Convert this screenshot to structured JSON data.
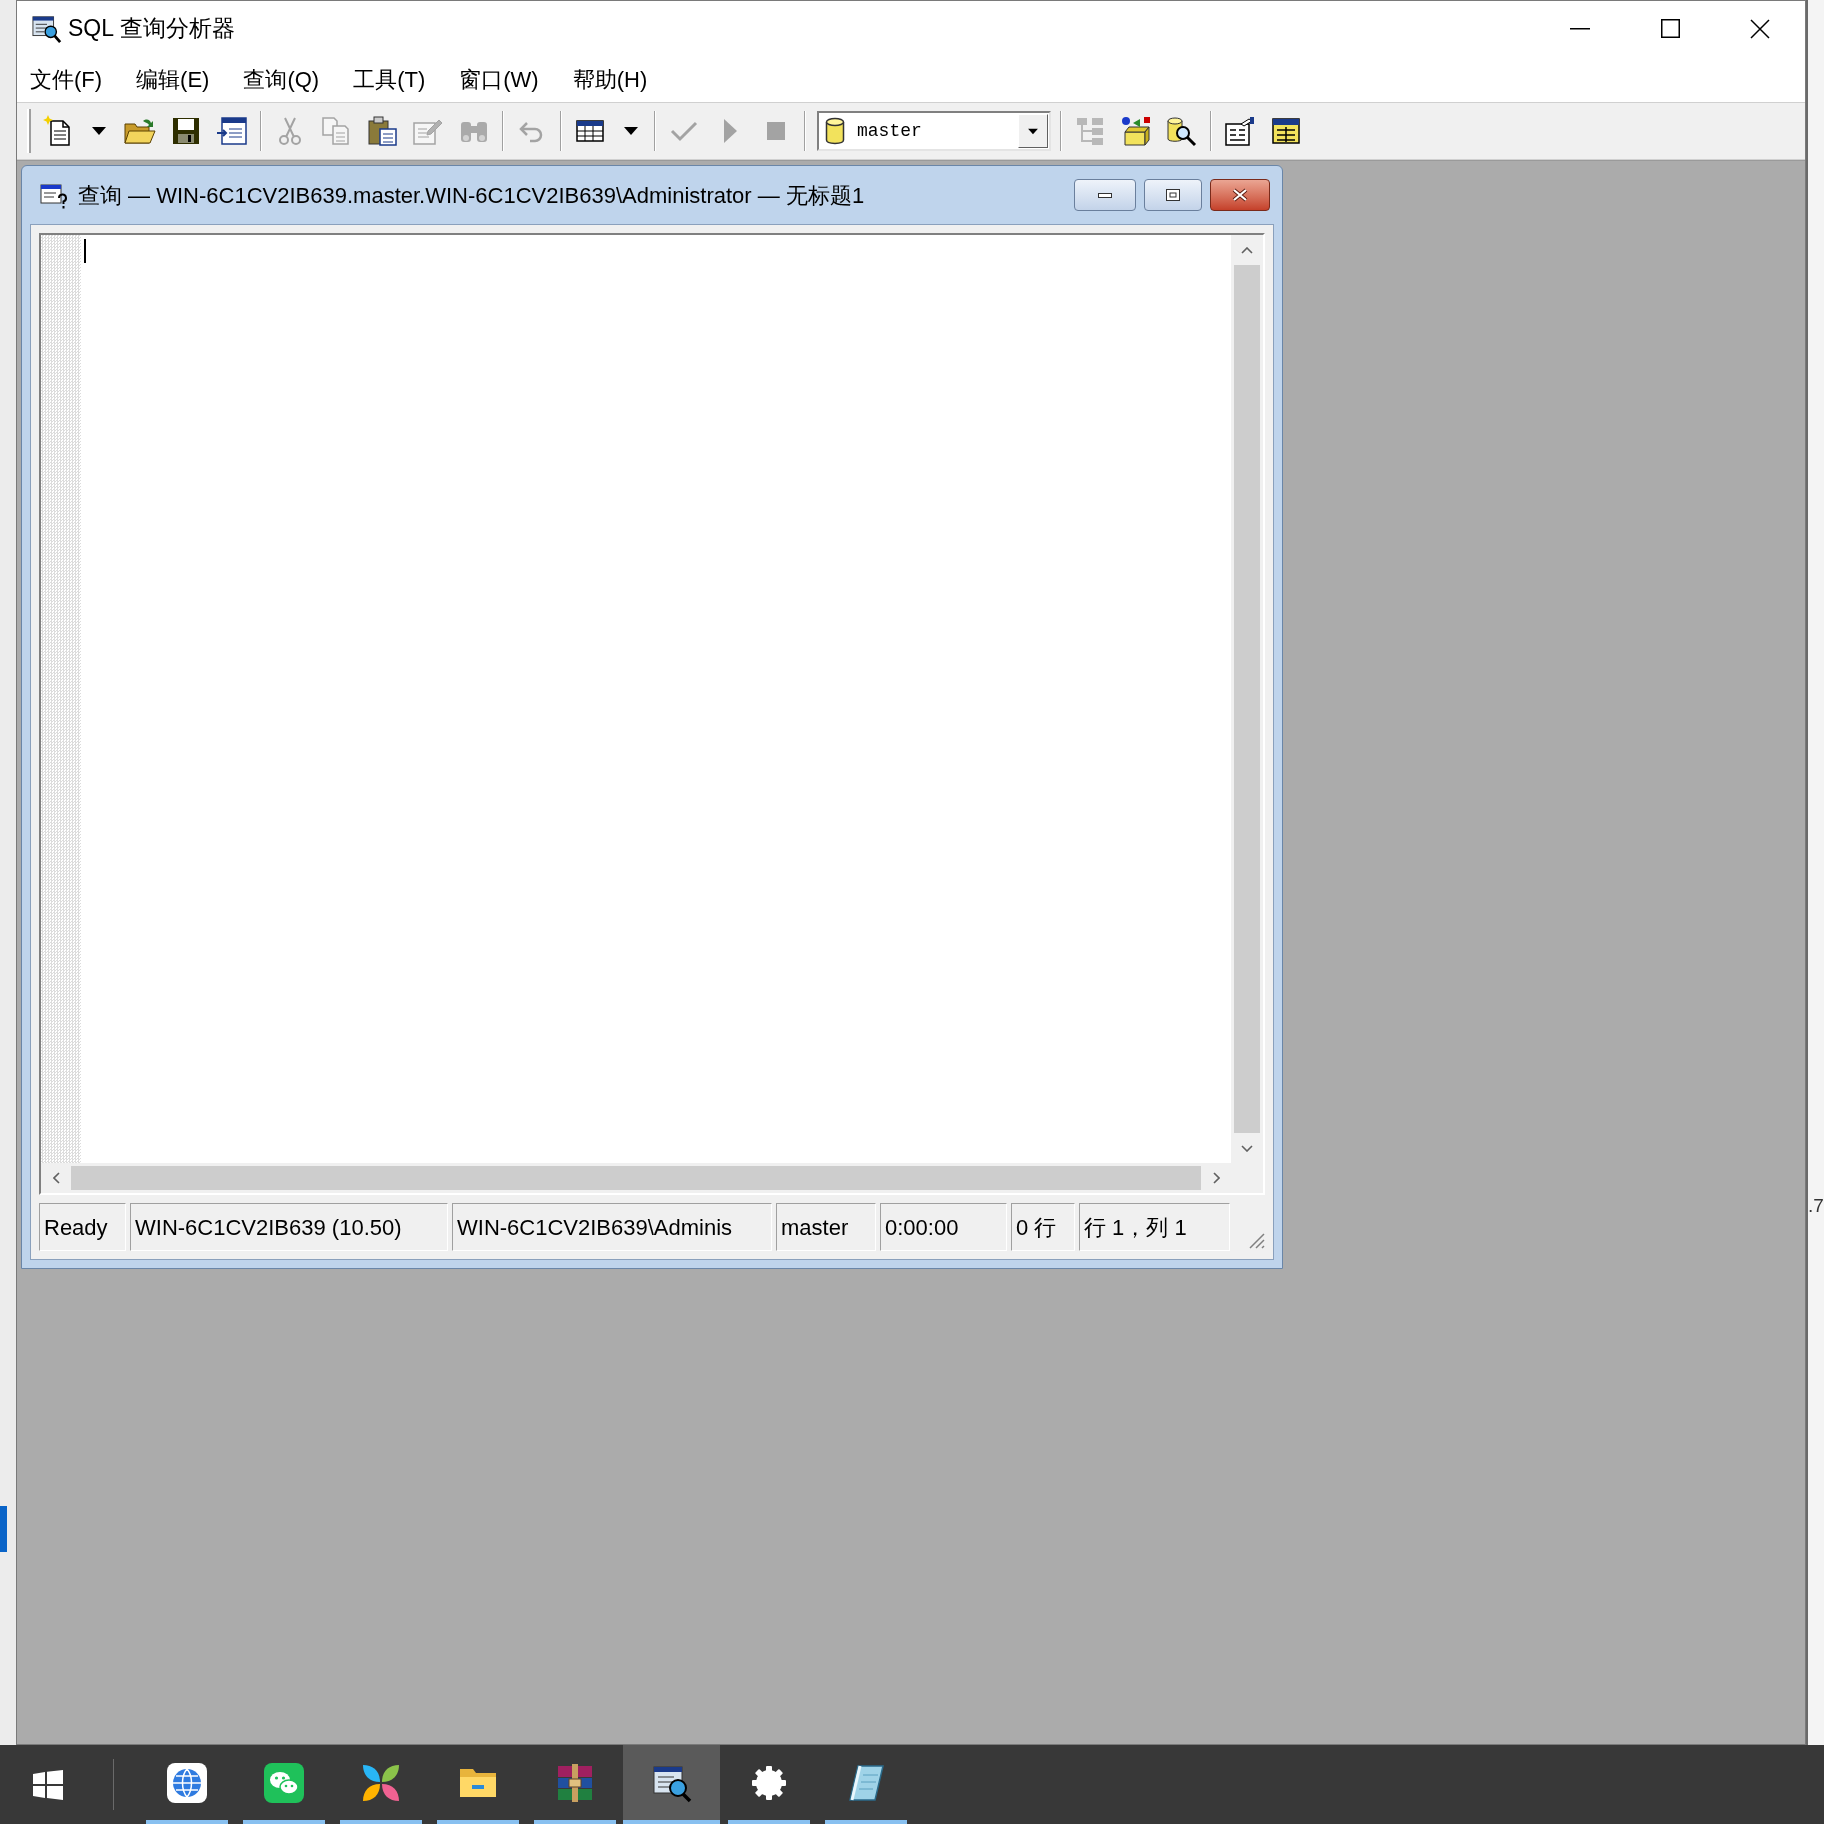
{
  "window": {
    "title": "SQL 查询分析器"
  },
  "menu": [
    {
      "label": "文件(F)"
    },
    {
      "label": "编辑(E)"
    },
    {
      "label": "查询(Q)"
    },
    {
      "label": "工具(T)"
    },
    {
      "label": "窗口(W)"
    },
    {
      "label": "帮助(H)"
    }
  ],
  "toolbar": {
    "items": [
      {
        "kind": "button",
        "disabled": false
      },
      {
        "kind": "menu_arrow",
        "disabled": false
      },
      {
        "kind": "button",
        "disabled": false
      },
      {
        "kind": "button",
        "disabled": false
      },
      {
        "kind": "button",
        "disabled": false
      },
      {
        "kind": "separator"
      },
      {
        "kind": "button",
        "disabled": true
      },
      {
        "kind": "button",
        "disabled": true
      },
      {
        "kind": "button",
        "disabled": false
      },
      {
        "kind": "button",
        "disabled": true
      },
      {
        "kind": "button",
        "disabled": true
      },
      {
        "kind": "separator"
      },
      {
        "kind": "button",
        "disabled": true
      },
      {
        "kind": "separator"
      },
      {
        "kind": "button",
        "disabled": false
      },
      {
        "kind": "menu_arrow",
        "disabled": false
      },
      {
        "kind": "separator"
      },
      {
        "kind": "button",
        "disabled": true
      },
      {
        "kind": "button",
        "disabled": true
      },
      {
        "kind": "button",
        "disabled": true
      },
      {
        "kind": "separator"
      },
      {
        "kind": "database_combo",
        "value": "master"
      },
      {
        "kind": "separator"
      },
      {
        "kind": "button",
        "disabled": true
      },
      {
        "kind": "button",
        "disabled": false
      },
      {
        "kind": "button",
        "disabled": false
      },
      {
        "kind": "separator"
      },
      {
        "kind": "button",
        "disabled": false
      },
      {
        "kind": "button",
        "disabled": false
      }
    ]
  },
  "query_window": {
    "title": "查询 — WIN-6C1CV2IB639.master.WIN-6C1CV2IB639\\Administrator — 无标题1",
    "editor": {
      "focused": true
    }
  },
  "status_bar": [
    "Ready",
    "WIN-6C1CV2IB639 (10.50)",
    "WIN-6C1CV2IB639\\Adminis",
    "master",
    "0:00:00",
    "0 行",
    "行 1，列 1"
  ],
  "background_window": {
    "text": ".7"
  },
  "taskbar": {
    "items": [
      {
        "running": true,
        "selected": false
      },
      {
        "running": true,
        "selected": false
      },
      {
        "running": true,
        "selected": false
      },
      {
        "running": true,
        "selected": false
      },
      {
        "running": true,
        "selected": false
      },
      {
        "running": true,
        "selected": true
      },
      {
        "running": true,
        "selected": false
      },
      {
        "running": true,
        "selected": false
      }
    ]
  }
}
